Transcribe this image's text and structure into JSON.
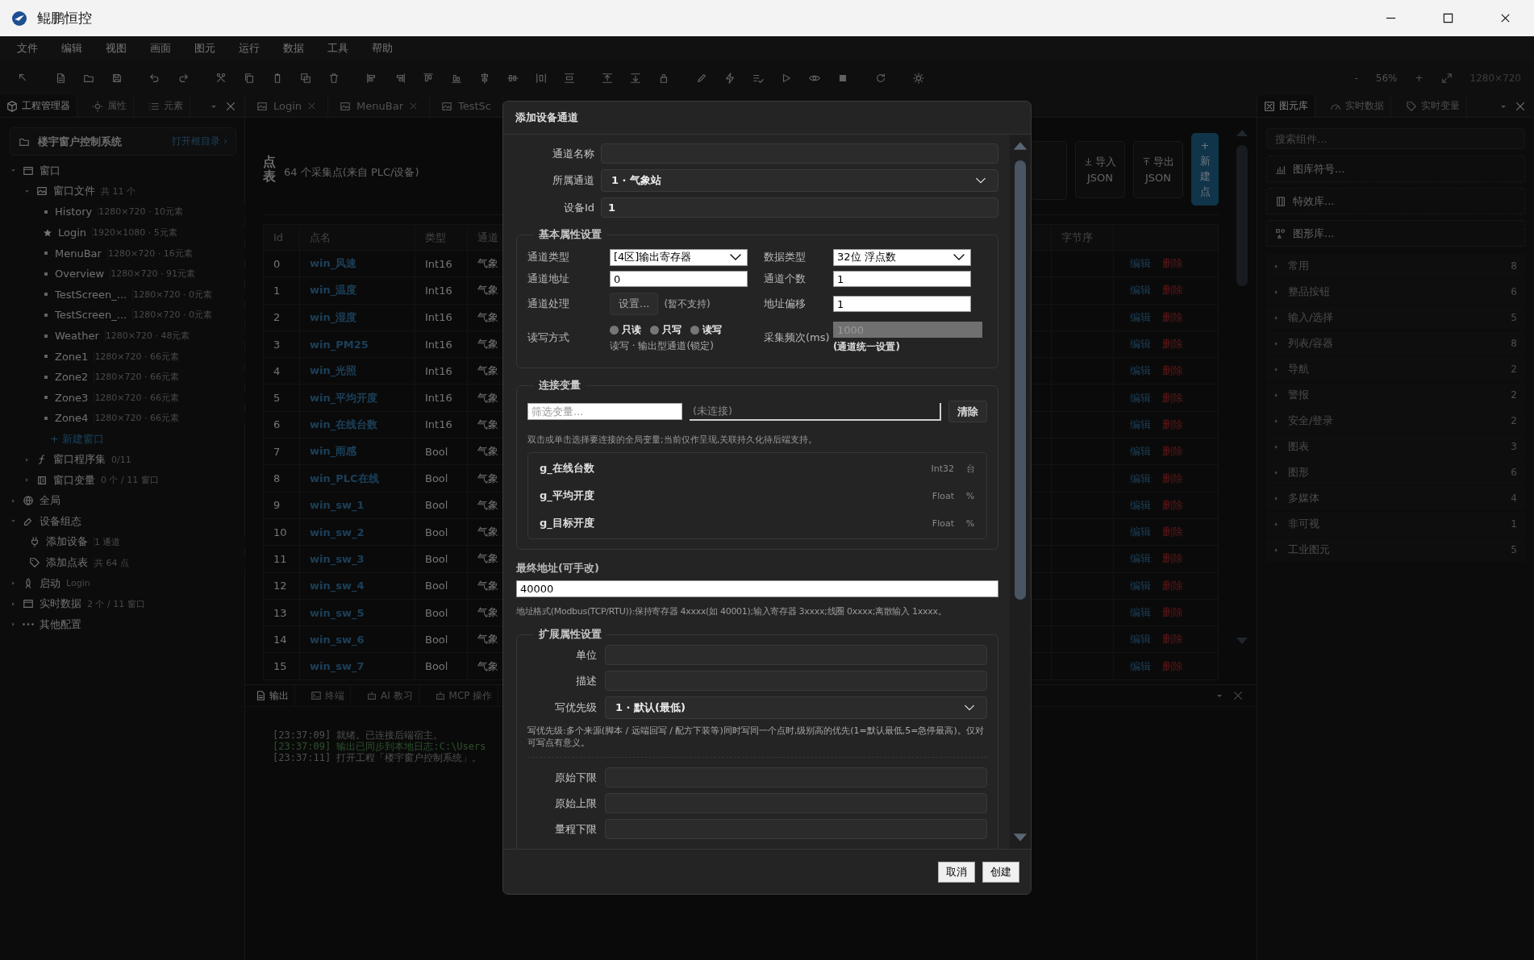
{
  "window": {
    "title": "鲲鹏恒控"
  },
  "menu": [
    "文件",
    "编辑",
    "视图",
    "画面",
    "图元",
    "运行",
    "数据",
    "工具",
    "帮助"
  ],
  "zoom": {
    "minus": "-",
    "value": "56%",
    "plus": "+",
    "canvas_size": "1280×720"
  },
  "left_panel": {
    "tabs": [
      {
        "label": "工程管理器",
        "selected": true
      },
      {
        "label": "属性",
        "selected": false
      },
      {
        "label": "元素",
        "selected": false
      }
    ],
    "project": {
      "name": "楼宇窗户控制系统",
      "link": "打开根目录 ›"
    },
    "tree": [
      {
        "kind": "windows",
        "label": "窗口",
        "expanded": true,
        "children": [
          {
            "kind": "window_files",
            "label": "窗口文件",
            "meta": "共 11 个",
            "expanded": true,
            "children": [
              {
                "kind": "page",
                "label": "History",
                "meta": "1280×720 · 10元素",
                "startup": false
              },
              {
                "kind": "page",
                "label": "Login",
                "meta": "1920×1080 · 5元素",
                "startup": true
              },
              {
                "kind": "page",
                "label": "MenuBar",
                "meta": "1280×720 · 16元素",
                "startup": false
              },
              {
                "kind": "page",
                "label": "Overview",
                "meta": "1280×720 · 91元素",
                "startup": false
              },
              {
                "kind": "page",
                "label": "TestScreen_...",
                "meta": "1280×720 · 0元素",
                "startup": false
              },
              {
                "kind": "page",
                "label": "TestScreen_...",
                "meta": "1280×720 · 0元素",
                "startup": false
              },
              {
                "kind": "page",
                "label": "Weather",
                "meta": "1280×720 · 48元素",
                "startup": false
              },
              {
                "kind": "page",
                "label": "Zone1",
                "meta": "1280×720 · 66元素",
                "startup": false
              },
              {
                "kind": "page",
                "label": "Zone2",
                "meta": "1280×720 · 66元素",
                "startup": false
              },
              {
                "kind": "page",
                "label": "Zone3",
                "meta": "1280×720 · 66元素",
                "startup": false
              },
              {
                "kind": "page",
                "label": "Zone4",
                "meta": "1280×720 · 66元素",
                "startup": false
              },
              {
                "kind": "add",
                "label": "+ 新建窗口"
              }
            ]
          },
          {
            "kind": "scripts",
            "label": "窗口程序集",
            "meta": "0/11",
            "expanded": false
          },
          {
            "kind": "variables",
            "label": "窗口变量",
            "meta": "0 个 / 11 窗口",
            "expanded": false
          }
        ]
      },
      {
        "kind": "global",
        "label": "全局",
        "expanded": false
      },
      {
        "kind": "devices",
        "label": "设备组态",
        "expanded": true,
        "children": [
          {
            "kind": "plug",
            "label": "添加设备",
            "meta": "1 通道"
          },
          {
            "kind": "points",
            "label": "添加点表",
            "meta": "共 64 点"
          }
        ]
      },
      {
        "kind": "startup",
        "label": "启动",
        "meta": "Login",
        "expanded": false
      },
      {
        "kind": "realtime",
        "label": "实时数据",
        "meta": "2 个 / 11 窗口",
        "expanded": false
      },
      {
        "kind": "other",
        "label": "其他配置",
        "expanded": false
      }
    ]
  },
  "editor_tabs": [
    {
      "label": "Login",
      "closable": true
    },
    {
      "label": "MenuBar",
      "closable": true
    },
    {
      "label": "TestSc",
      "closable": false
    }
  ],
  "point_table": {
    "title": "点表",
    "summary": "64 个采集点(来自 PLC/设备)",
    "buttons": [
      {
        "kind": "import",
        "label": "导入 JSON"
      },
      {
        "kind": "export",
        "label": "导出 JSON"
      },
      {
        "kind": "new",
        "label": "+ 新建点"
      }
    ],
    "columns": [
      "Id",
      "点名",
      "类型",
      "通道",
      "字节序"
    ],
    "rows": [
      {
        "id": "0",
        "name": "win_风速",
        "type": "Int16",
        "channel": "气象",
        "edit": "编辑",
        "delete": "删除"
      },
      {
        "id": "1",
        "name": "win_温度",
        "type": "Int16",
        "channel": "气象",
        "edit": "编辑",
        "delete": "删除"
      },
      {
        "id": "2",
        "name": "win_湿度",
        "type": "Int16",
        "channel": "气象",
        "edit": "编辑",
        "delete": "删除"
      },
      {
        "id": "3",
        "name": "win_PM25",
        "type": "Int16",
        "channel": "气象",
        "edit": "编辑",
        "delete": "删除"
      },
      {
        "id": "4",
        "name": "win_光照",
        "type": "Int16",
        "channel": "气象",
        "edit": "编辑",
        "delete": "删除"
      },
      {
        "id": "5",
        "name": "win_平均开度",
        "type": "Int16",
        "channel": "气象",
        "edit": "编辑",
        "delete": "删除"
      },
      {
        "id": "6",
        "name": "win_在线台数",
        "type": "Int16",
        "channel": "气象",
        "edit": "编辑",
        "delete": "删除"
      },
      {
        "id": "7",
        "name": "win_雨感",
        "type": "Bool",
        "channel": "气象",
        "edit": "编辑",
        "delete": "删除"
      },
      {
        "id": "8",
        "name": "win_PLC在线",
        "type": "Bool",
        "channel": "气象",
        "edit": "编辑",
        "delete": "删除"
      },
      {
        "id": "9",
        "name": "win_sw_1",
        "type": "Bool",
        "channel": "气象",
        "edit": "编辑",
        "delete": "删除"
      },
      {
        "id": "10",
        "name": "win_sw_2",
        "type": "Bool",
        "channel": "气象",
        "edit": "编辑",
        "delete": "删除"
      },
      {
        "id": "11",
        "name": "win_sw_3",
        "type": "Bool",
        "channel": "气象",
        "edit": "编辑",
        "delete": "删除"
      },
      {
        "id": "12",
        "name": "win_sw_4",
        "type": "Bool",
        "channel": "气象",
        "edit": "编辑",
        "delete": "删除"
      },
      {
        "id": "13",
        "name": "win_sw_5",
        "type": "Bool",
        "channel": "气象",
        "edit": "编辑",
        "delete": "删除"
      },
      {
        "id": "14",
        "name": "win_sw_6",
        "type": "Bool",
        "channel": "气象",
        "edit": "编辑",
        "delete": "删除"
      },
      {
        "id": "15",
        "name": "win_sw_7",
        "type": "Bool",
        "channel": "气象",
        "edit": "编辑",
        "delete": "删除"
      }
    ]
  },
  "output_panel": {
    "tabs": [
      {
        "label": "输出",
        "selected": true
      },
      {
        "label": "终端",
        "selected": false
      },
      {
        "label": "AI 教习",
        "selected": false
      },
      {
        "label": "MCP 操作",
        "selected": false
      }
    ],
    "log": [
      {
        "kind": "info",
        "time": "[23:37:09]",
        "text": "就绪。已连接后端宿主。"
      },
      {
        "kind": "success",
        "time": "[23:37:09]",
        "text": "输出已同步到本地日志:C:\\Users"
      },
      {
        "kind": "info",
        "time": "[23:37:11]",
        "text": "打开工程「楼宇窗户控制系统」。"
      }
    ]
  },
  "right_panel": {
    "tabs": [
      {
        "label": "图元库",
        "selected": true
      },
      {
        "label": "实时数据",
        "selected": false
      },
      {
        "label": "实时变量",
        "selected": false
      }
    ],
    "search": {
      "placeholder": "搜索组件..."
    },
    "libraries": [
      "图库符号...",
      "特效库...",
      "图形库..."
    ],
    "categories": [
      {
        "label": "常用",
        "count": "8",
        "expanded": false
      },
      {
        "label": "整品按钮",
        "count": "6",
        "expanded": false
      },
      {
        "label": "输入/选择",
        "count": "5",
        "expanded": false
      },
      {
        "label": "列表/容器",
        "count": "8",
        "expanded": false
      },
      {
        "label": "导航",
        "count": "2",
        "expanded": false
      },
      {
        "label": "警报",
        "count": "2",
        "expanded": false
      },
      {
        "label": "安全/登录",
        "count": "2",
        "expanded": false
      },
      {
        "label": "图表",
        "count": "3",
        "expanded": false
      },
      {
        "label": "图形",
        "count": "6",
        "expanded": false
      },
      {
        "label": "多媒体",
        "count": "4",
        "expanded": false
      },
      {
        "label": "非可视",
        "count": "1",
        "expanded": false
      },
      {
        "label": "工业图元",
        "count": "5",
        "expanded": false
      }
    ]
  },
  "dialog": {
    "title": "添加设备通道",
    "fields": [
      {
        "kind": "input",
        "label": "通道名称"
      },
      {
        "kind": "select",
        "label": "所属通道",
        "value": "1 · 气象站"
      },
      {
        "kind": "input",
        "label": "设备Id",
        "value": "1"
      }
    ],
    "basic": {
      "legend": "基本属性设置",
      "channel_type": {
        "label": "通道类型",
        "value": "[4区]输出寄存器"
      },
      "data_type": {
        "label": "数据类型",
        "value": "32位 浮点数"
      },
      "address": {
        "label": "通道地址",
        "value": "0"
      },
      "count": {
        "label": "通道个数",
        "value": "1"
      },
      "processing": {
        "label": "通道处理",
        "button": "设置...",
        "note": "(暂不支持)"
      },
      "offset": {
        "label": "地址偏移",
        "value": "1"
      },
      "rw_mode": {
        "label": "读写方式",
        "options": [
          {
            "label": "只读",
            "selected": false
          },
          {
            "label": "只写",
            "selected": false
          },
          {
            "label": "读写",
            "selected": false
          }
        ],
        "note": "读写 · 输出型通道(锁定)"
      },
      "interval": {
        "label": "采集频次(ms)",
        "value": "1000",
        "disabled": true,
        "note": "(通道统一设置)"
      }
    },
    "link": {
      "legend": "连接变量",
      "filter_placeholder": "筛选变量...",
      "connected": "(未连接)",
      "clear": "清除",
      "hint": "双击或单击选择要连接的全局变量;当前仅作呈现,关联持久化待后端支持。",
      "variables": [
        {
          "name": "g_在线台数",
          "type": "Int32",
          "unit": "台"
        },
        {
          "name": "g_平均开度",
          "type": "Float",
          "unit": "%"
        },
        {
          "name": "g_目标开度",
          "type": "Float",
          "unit": "%"
        }
      ]
    },
    "final_address": {
      "label": "最终地址(可手改)",
      "value": "40000",
      "hint": "地址格式(Modbus(TCP/RTU)):保持寄存器 4xxxx(如 40001);输入寄存器 3xxxx;线圈 0xxxx;离散输入 1xxxx。"
    },
    "extended": {
      "legend": "扩展属性设置",
      "fields": [
        {
          "kind": "input",
          "label": "单位"
        },
        {
          "kind": "input",
          "label": "描述"
        },
        {
          "kind": "select",
          "label": "写优先级",
          "value": "1 · 默认(最低)"
        },
        {
          "kind": "note",
          "text": "写优先级:多个来源(脚本 / 远端回写 / 配方下装等)同时写同一个点时,级别高的优先(1=默认最低,5=急停最高)。仅对可写点有意义。"
        },
        {
          "kind": "divider"
        },
        {
          "kind": "input",
          "label": "原始下限"
        },
        {
          "kind": "input",
          "label": "原始上限"
        },
        {
          "kind": "input",
          "label": "量程下限"
        }
      ]
    },
    "buttons": [
      "取消",
      "创建"
    ]
  }
}
